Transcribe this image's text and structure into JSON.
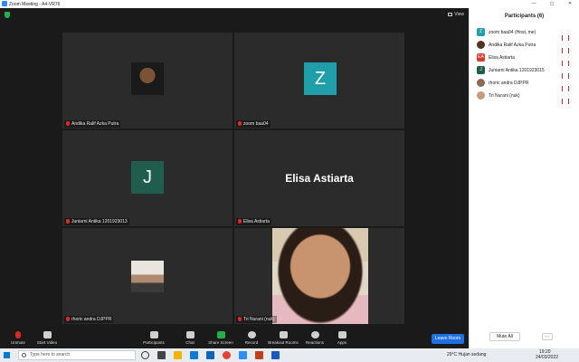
{
  "window": {
    "title": "Zoom Meeting - A4-VR76",
    "controls": [
      "—",
      "◻",
      "✕"
    ]
  },
  "meeting": {
    "view_label": "View",
    "tiles": [
      {
        "name": "Andika Ralif Azka Putra",
        "kind": "photo",
        "muted": true
      },
      {
        "name": "zoom baa04",
        "kind": "avatar",
        "initial": "Z",
        "color": "#1f9faa",
        "muted": true
      },
      {
        "name": "Juniarni Antika 1201923013",
        "kind": "avatar",
        "initial": "J",
        "color": "#1f5e4c",
        "muted": true
      },
      {
        "name": "Elisa Astiarta",
        "kind": "text",
        "display": "Elisa Astiarta",
        "muted": true
      },
      {
        "name": "rhoric andra DJPPR",
        "kind": "photo",
        "muted": true
      },
      {
        "name": "Tri Nurani (nuk)",
        "kind": "video",
        "muted": true
      }
    ]
  },
  "toolbar": {
    "unmute": "Unmute",
    "start_video": "Start Video",
    "participants": "Participants",
    "participants_count": "6",
    "chat": "Chat",
    "share_screen": "Share Screen",
    "record": "Record",
    "breakout_rooms": "Breakout Rooms",
    "reactions": "Reactions",
    "apps": "Apps",
    "leave": "Leave Room"
  },
  "panel": {
    "title": "Participants (6)",
    "participants": [
      {
        "name": "zoom baa04 (Host, me)",
        "initial": "Z",
        "color": "#1f9faa"
      },
      {
        "name": "Andika Ralif Azka Putra",
        "initial": "",
        "color": "#553322"
      },
      {
        "name": "Elisa Astiarta",
        "initial": "EA",
        "color": "#d93a2b"
      },
      {
        "name": "Juniarni Antika 1201923015",
        "initial": "J",
        "color": "#1f5e4c"
      },
      {
        "name": "rhoric andra DJPPR",
        "initial": "",
        "color": "#8a6a55"
      },
      {
        "name": "Tri Nurani (nuk)",
        "initial": "",
        "color": "#c89a7a"
      }
    ],
    "mute_all": "Mute All",
    "more": "..."
  },
  "taskbar": {
    "search_placeholder": "Type here to search",
    "weather": "29°C  Hujan sedang",
    "time": "19:20",
    "date": "24/03/2022"
  }
}
